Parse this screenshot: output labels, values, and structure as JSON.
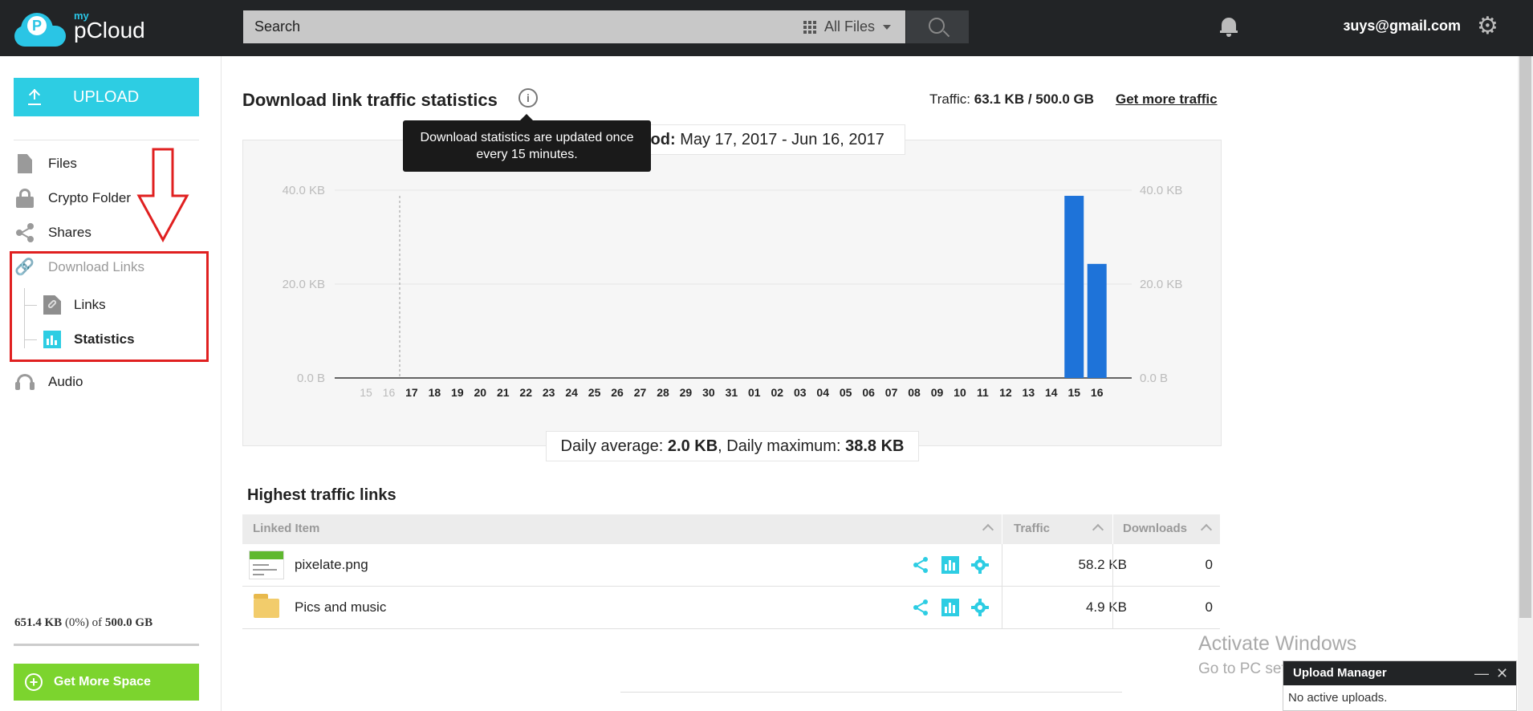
{
  "header": {
    "logo_my": "my",
    "logo_name": "pCloud",
    "search_placeholder": "Search",
    "search_filter": "All Files",
    "user_email": "ɜuys@gmail.com"
  },
  "sidebar": {
    "upload_label": "UPLOAD",
    "items": [
      {
        "label": "Files",
        "icon": "file-icon"
      },
      {
        "label": "Crypto Folder",
        "icon": "lock-icon"
      },
      {
        "label": "Shares",
        "icon": "share-icon"
      },
      {
        "label": "Download Links",
        "icon": "link-icon"
      },
      {
        "label": "Audio",
        "icon": "headphones-icon"
      }
    ],
    "sub_items": [
      {
        "label": "Links",
        "icon": "link-document-icon"
      },
      {
        "label": "Statistics",
        "icon": "bar-chart-icon"
      }
    ],
    "storage_used": "651.4 KB",
    "storage_pct": "(0%) of",
    "storage_total": "500.0 GB",
    "storage_fraction": 0.0013,
    "get_more_space": "Get More Space"
  },
  "main": {
    "title": "Download link traffic statistics",
    "traffic_label": "Traffic:",
    "traffic_value": "63.1 KB / 500.0 GB",
    "get_more_traffic": "Get more traffic",
    "tooltip": "Download statistics are updated once every 15 minutes.",
    "period_label": "iod:",
    "period_value": "May 17, 2017 - Jun 16, 2017",
    "daily_avg_label": "Daily average:",
    "daily_avg_value": "2.0 KB",
    "daily_max_label": ", Daily maximum:",
    "daily_max_value": "38.8 KB"
  },
  "chart_data": {
    "type": "bar",
    "categories": [
      "15",
      "16",
      "17",
      "18",
      "19",
      "20",
      "21",
      "22",
      "23",
      "24",
      "25",
      "26",
      "27",
      "28",
      "29",
      "30",
      "31",
      "01",
      "02",
      "03",
      "04",
      "05",
      "06",
      "07",
      "08",
      "09",
      "10",
      "11",
      "12",
      "13",
      "14",
      "15",
      "16"
    ],
    "values": [
      0,
      0,
      0,
      0,
      0,
      0,
      0,
      0,
      0,
      0,
      0,
      0,
      0,
      0,
      0,
      0,
      0,
      0,
      0,
      0,
      0,
      0,
      0,
      0,
      0,
      0,
      0,
      0,
      0,
      0,
      0,
      38.8,
      24.3
    ],
    "ylabel": "",
    "ylim": [
      0,
      40
    ],
    "y_ticks": [
      "0.0 B",
      "20.0 KB",
      "40.0 KB"
    ],
    "grid": true,
    "bar_color": "#1e73d9"
  },
  "table": {
    "title": "Highest traffic links",
    "headers": {
      "item": "Linked Item",
      "traffic": "Traffic",
      "downloads": "Downloads"
    },
    "rows": [
      {
        "name": "pixelate.png",
        "traffic": "58.2 KB",
        "downloads": "0",
        "thumb": "image-thumbnail"
      },
      {
        "name": "Pics and music",
        "traffic": "4.9 KB",
        "downloads": "0",
        "thumb": "folder-icon"
      }
    ]
  },
  "overlay": {
    "activate_title": "Activate Windows",
    "activate_sub": "Go to PC settings to activate Windows.",
    "upload_manager_title": "Upload Manager",
    "upload_manager_body": "No active uploads."
  },
  "colors": {
    "accent": "#2dcde3",
    "green": "#7cd42e",
    "highlight": "#e02020",
    "bar": "#1e73d9"
  }
}
